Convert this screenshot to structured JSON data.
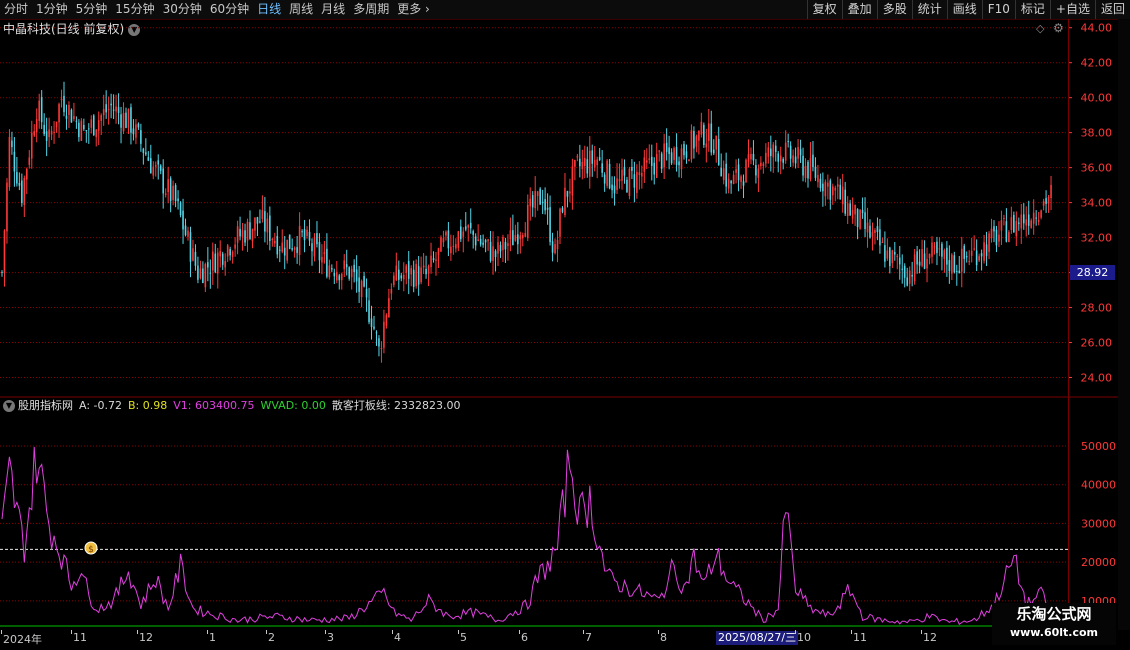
{
  "toolbar": {
    "periods": [
      "分时",
      "1分钟",
      "5分钟",
      "15分钟",
      "30分钟",
      "60分钟",
      "日线",
      "周线",
      "月线",
      "多周期",
      "更多"
    ],
    "active_period": "日线",
    "right_buttons": [
      "复权",
      "叠加",
      "多股",
      "统计",
      "画线",
      "F10",
      "标记",
      "+自选",
      "返回"
    ]
  },
  "chart_title": "中晶科技(日线 前复权)",
  "current_price": "28.92",
  "indicator": {
    "name": "股朋指标网",
    "values": [
      {
        "label": "A:",
        "value": "-0.72",
        "color": "#d8d8d8"
      },
      {
        "label": "B:",
        "value": "0.98",
        "color": "#e0e020"
      },
      {
        "label": "V1:",
        "value": "603400.75",
        "color": "#e040e0"
      },
      {
        "label": "WVAD:",
        "value": "0.00",
        "color": "#30d030"
      },
      {
        "label": "散客打板线:",
        "value": "2332823.00",
        "color": "#d8d8d8"
      }
    ]
  },
  "colors": {
    "up": "#ff3838",
    "down": "#54d6e8",
    "line": "#e040e0",
    "baseline": "#00c000",
    "axis": "#ff3838"
  },
  "chart_data": [
    {
      "type": "candlestick",
      "title": "中晶科技(日线 前复权)",
      "y_ticks": [
        24,
        26,
        28,
        30,
        32,
        34,
        36,
        38,
        40,
        42,
        44
      ],
      "ylim": [
        23,
        44.5
      ],
      "x_ticks": [
        "2024年",
        "11",
        "12",
        "1",
        "2",
        "3",
        "4",
        "5",
        "6",
        "7",
        "8",
        "10",
        "11",
        "12"
      ],
      "close_keypoints": [
        [
          0,
          30.0
        ],
        [
          3,
          37.5
        ],
        [
          8,
          34.5
        ],
        [
          14,
          39.5
        ],
        [
          19,
          37.5
        ],
        [
          24,
          40.0
        ],
        [
          33,
          38.0
        ],
        [
          44,
          39.5
        ],
        [
          52,
          38.5
        ],
        [
          61,
          36.0
        ],
        [
          70,
          34.0
        ],
        [
          79,
          30.0
        ],
        [
          84,
          30.5
        ],
        [
          93,
          31.8
        ],
        [
          104,
          33.0
        ],
        [
          113,
          31.5
        ],
        [
          121,
          32.0
        ],
        [
          131,
          30.5
        ],
        [
          141,
          30.0
        ],
        [
          149,
          27.5
        ],
        [
          152,
          25.5
        ],
        [
          157,
          29.5
        ],
        [
          164,
          30.0
        ],
        [
          171,
          29.8
        ],
        [
          178,
          31.5
        ],
        [
          187,
          32.5
        ],
        [
          199,
          31.0
        ],
        [
          206,
          32.0
        ],
        [
          218,
          34.5
        ],
        [
          223,
          31.0
        ],
        [
          226,
          34.0
        ],
        [
          232,
          36.0
        ],
        [
          240,
          36.5
        ],
        [
          247,
          35.0
        ],
        [
          256,
          35.5
        ],
        [
          265,
          36.5
        ],
        [
          275,
          37.0
        ],
        [
          283,
          38.0
        ],
        [
          287,
          37.5
        ],
        [
          293,
          35.0
        ],
        [
          301,
          36.0
        ],
        [
          313,
          37.0
        ],
        [
          320,
          36.5
        ],
        [
          329,
          35.5
        ],
        [
          337,
          34.5
        ],
        [
          345,
          33.0
        ],
        [
          357,
          31.0
        ],
        [
          365,
          30.0
        ],
        [
          373,
          31.0
        ],
        [
          385,
          30.5
        ],
        [
          396,
          31.5
        ],
        [
          405,
          32.5
        ],
        [
          416,
          33.5
        ],
        [
          423,
          34.5
        ]
      ]
    },
    {
      "type": "line",
      "series_name": "V1",
      "y_ticks": [
        10000,
        20000,
        30000,
        40000,
        50000
      ],
      "ylim": [
        3000,
        58000
      ],
      "reference_line": 23300,
      "keypoints": [
        [
          0,
          28000
        ],
        [
          3,
          43000
        ],
        [
          6,
          33000
        ],
        [
          9,
          24000
        ],
        [
          14,
          48000
        ],
        [
          19,
          30000
        ],
        [
          24,
          22000
        ],
        [
          28,
          14000
        ],
        [
          32,
          19000
        ],
        [
          35,
          11000
        ],
        [
          39,
          8000
        ],
        [
          45,
          10000
        ],
        [
          51,
          18000
        ],
        [
          56,
          9000
        ],
        [
          62,
          16000
        ],
        [
          67,
          8000
        ],
        [
          72,
          19000
        ],
        [
          77,
          8000
        ],
        [
          85,
          6500
        ],
        [
          95,
          5000
        ],
        [
          110,
          6000
        ],
        [
          125,
          5000
        ],
        [
          140,
          5500
        ],
        [
          154,
          12000
        ],
        [
          158,
          7000
        ],
        [
          165,
          5000
        ],
        [
          172,
          10000
        ],
        [
          180,
          6000
        ],
        [
          190,
          7000
        ],
        [
          200,
          5000
        ],
        [
          212,
          9000
        ],
        [
          216,
          16000
        ],
        [
          221,
          20000
        ],
        [
          224,
          24000
        ],
        [
          229,
          47000
        ],
        [
          233,
          32000
        ],
        [
          237,
          36000
        ],
        [
          240,
          27000
        ],
        [
          244,
          16000
        ],
        [
          250,
          14000
        ],
        [
          258,
          12000
        ],
        [
          265,
          10000
        ],
        [
          271,
          19000
        ],
        [
          275,
          13000
        ],
        [
          279,
          21000
        ],
        [
          283,
          14000
        ],
        [
          288,
          22000
        ],
        [
          293,
          15000
        ],
        [
          300,
          10000
        ],
        [
          307,
          5000
        ],
        [
          313,
          8000
        ],
        [
          316,
          35000
        ],
        [
          320,
          13000
        ],
        [
          326,
          8000
        ],
        [
          334,
          6000
        ],
        [
          342,
          13000
        ],
        [
          347,
          6000
        ],
        [
          355,
          5000
        ],
        [
          366,
          4500
        ],
        [
          374,
          6000
        ],
        [
          382,
          4500
        ],
        [
          392,
          5000
        ],
        [
          400,
          9000
        ],
        [
          408,
          21000
        ],
        [
          413,
          9000
        ],
        [
          420,
          12000
        ],
        [
          423,
          6000
        ]
      ]
    }
  ]
}
